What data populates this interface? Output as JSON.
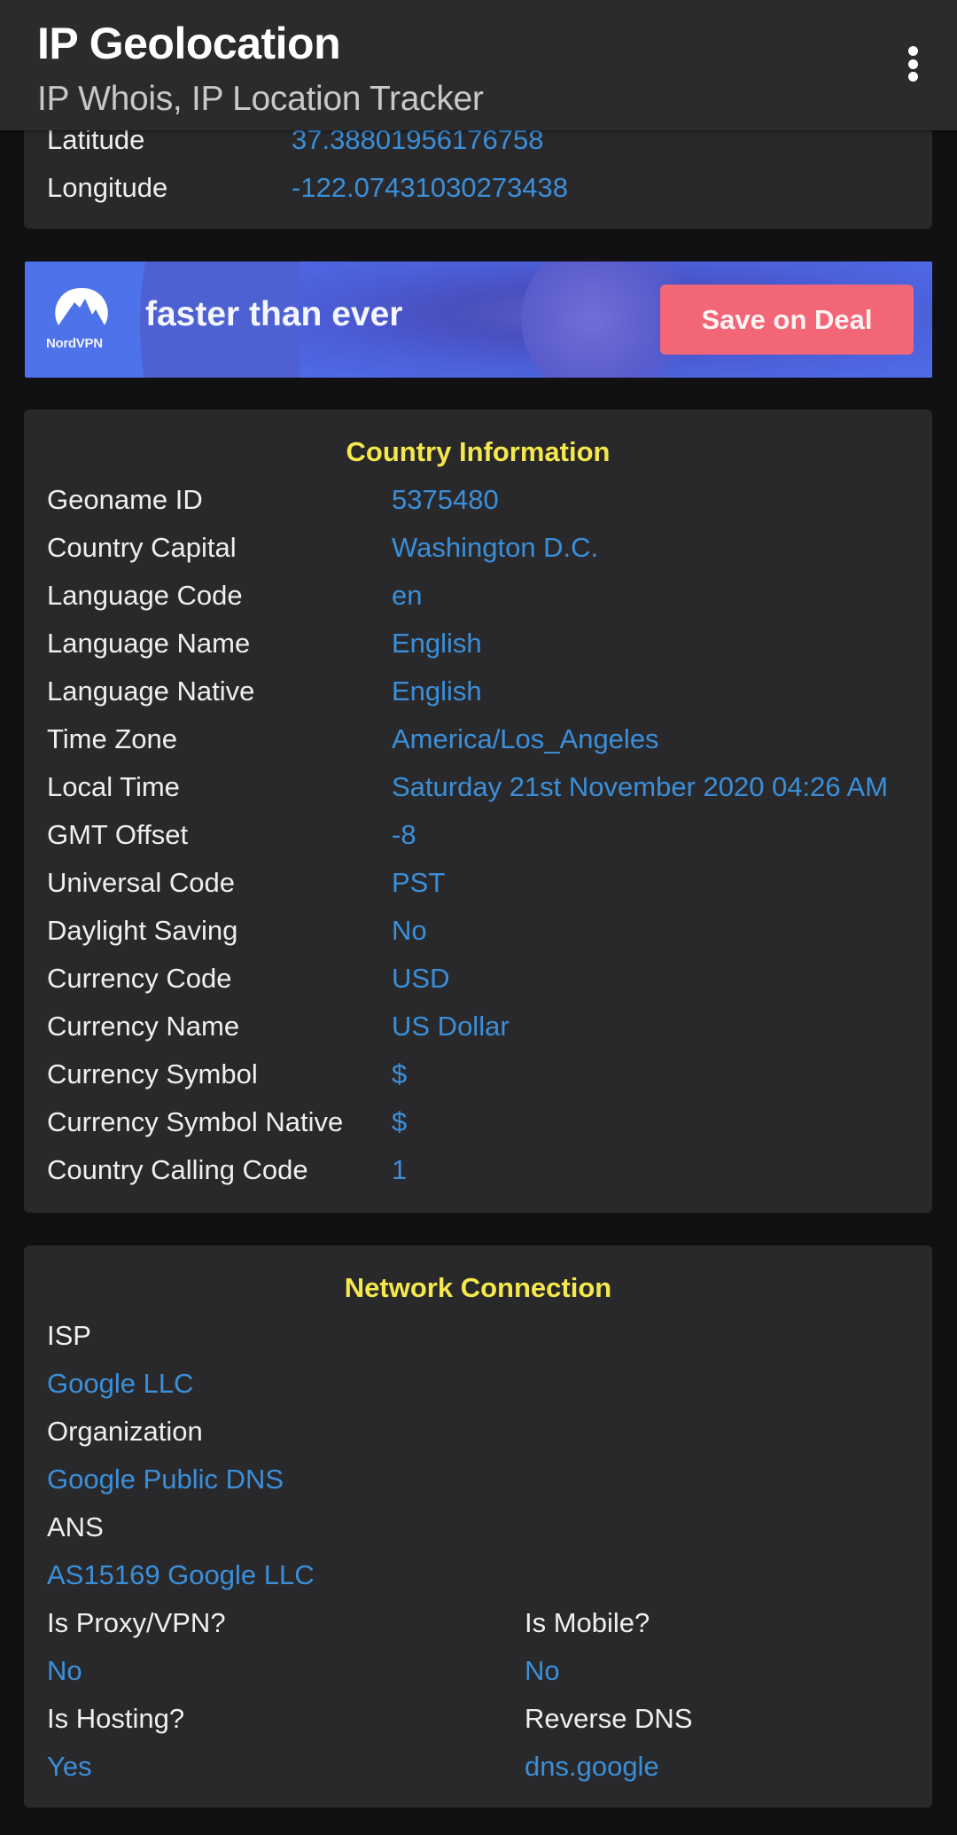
{
  "app_bar": {
    "title": "IP Geolocation",
    "subtitle": "IP Whois, IP Location Tracker",
    "overflow_icon": "more-vert-icon"
  },
  "location": {
    "rows": [
      {
        "label": "Latitude",
        "value": "37.38801956176758"
      },
      {
        "label": "Longitude",
        "value": "-122.07431030273438"
      }
    ]
  },
  "ad": {
    "brand": "NordVPN",
    "headline": "faster than ever",
    "cta": "Save on Deal",
    "colors": {
      "background": "#4d72ea",
      "cta": "#f26677"
    }
  },
  "country": {
    "title": "Country Information",
    "rows": [
      {
        "label": "Geoname ID",
        "value": "5375480"
      },
      {
        "label": "Country Capital",
        "value": "Washington D.C."
      },
      {
        "label": "Language Code",
        "value": "en"
      },
      {
        "label": "Language Name",
        "value": "English"
      },
      {
        "label": "Language Native",
        "value": "English"
      },
      {
        "label": "Time Zone",
        "value": "America/Los_Angeles"
      },
      {
        "label": "Local Time",
        "value": "Saturday 21st November 2020 04:26 AM"
      },
      {
        "label": "GMT Offset",
        "value": "-8"
      },
      {
        "label": "Universal Code",
        "value": "PST"
      },
      {
        "label": "Daylight Saving",
        "value": "No"
      },
      {
        "label": "Currency Code",
        "value": "USD"
      },
      {
        "label": "Currency Name",
        "value": "US Dollar"
      },
      {
        "label": "Currency Symbol",
        "value": "$"
      },
      {
        "label": "Currency Symbol Native",
        "value": "$"
      },
      {
        "label": "Country Calling Code",
        "value": "1"
      }
    ]
  },
  "network": {
    "title": "Network Connection",
    "isp_label": "ISP",
    "isp_value": "Google LLC",
    "org_label": "Organization",
    "org_value": "Google Public DNS",
    "ans_label": "ANS",
    "ans_value": "AS15169 Google LLC",
    "proxy_label": "Is Proxy/VPN?",
    "proxy_value": "No",
    "mobile_label": "Is Mobile?",
    "mobile_value": "No",
    "hosting_label": "Is Hosting?",
    "hosting_value": "Yes",
    "rdns_label": "Reverse DNS",
    "rdns_value": "dns.google"
  },
  "colors": {
    "background": "#111113",
    "card": "#29292b",
    "label": "#efefef",
    "value": "#3b8fd9",
    "section_title": "#f5e84c"
  }
}
